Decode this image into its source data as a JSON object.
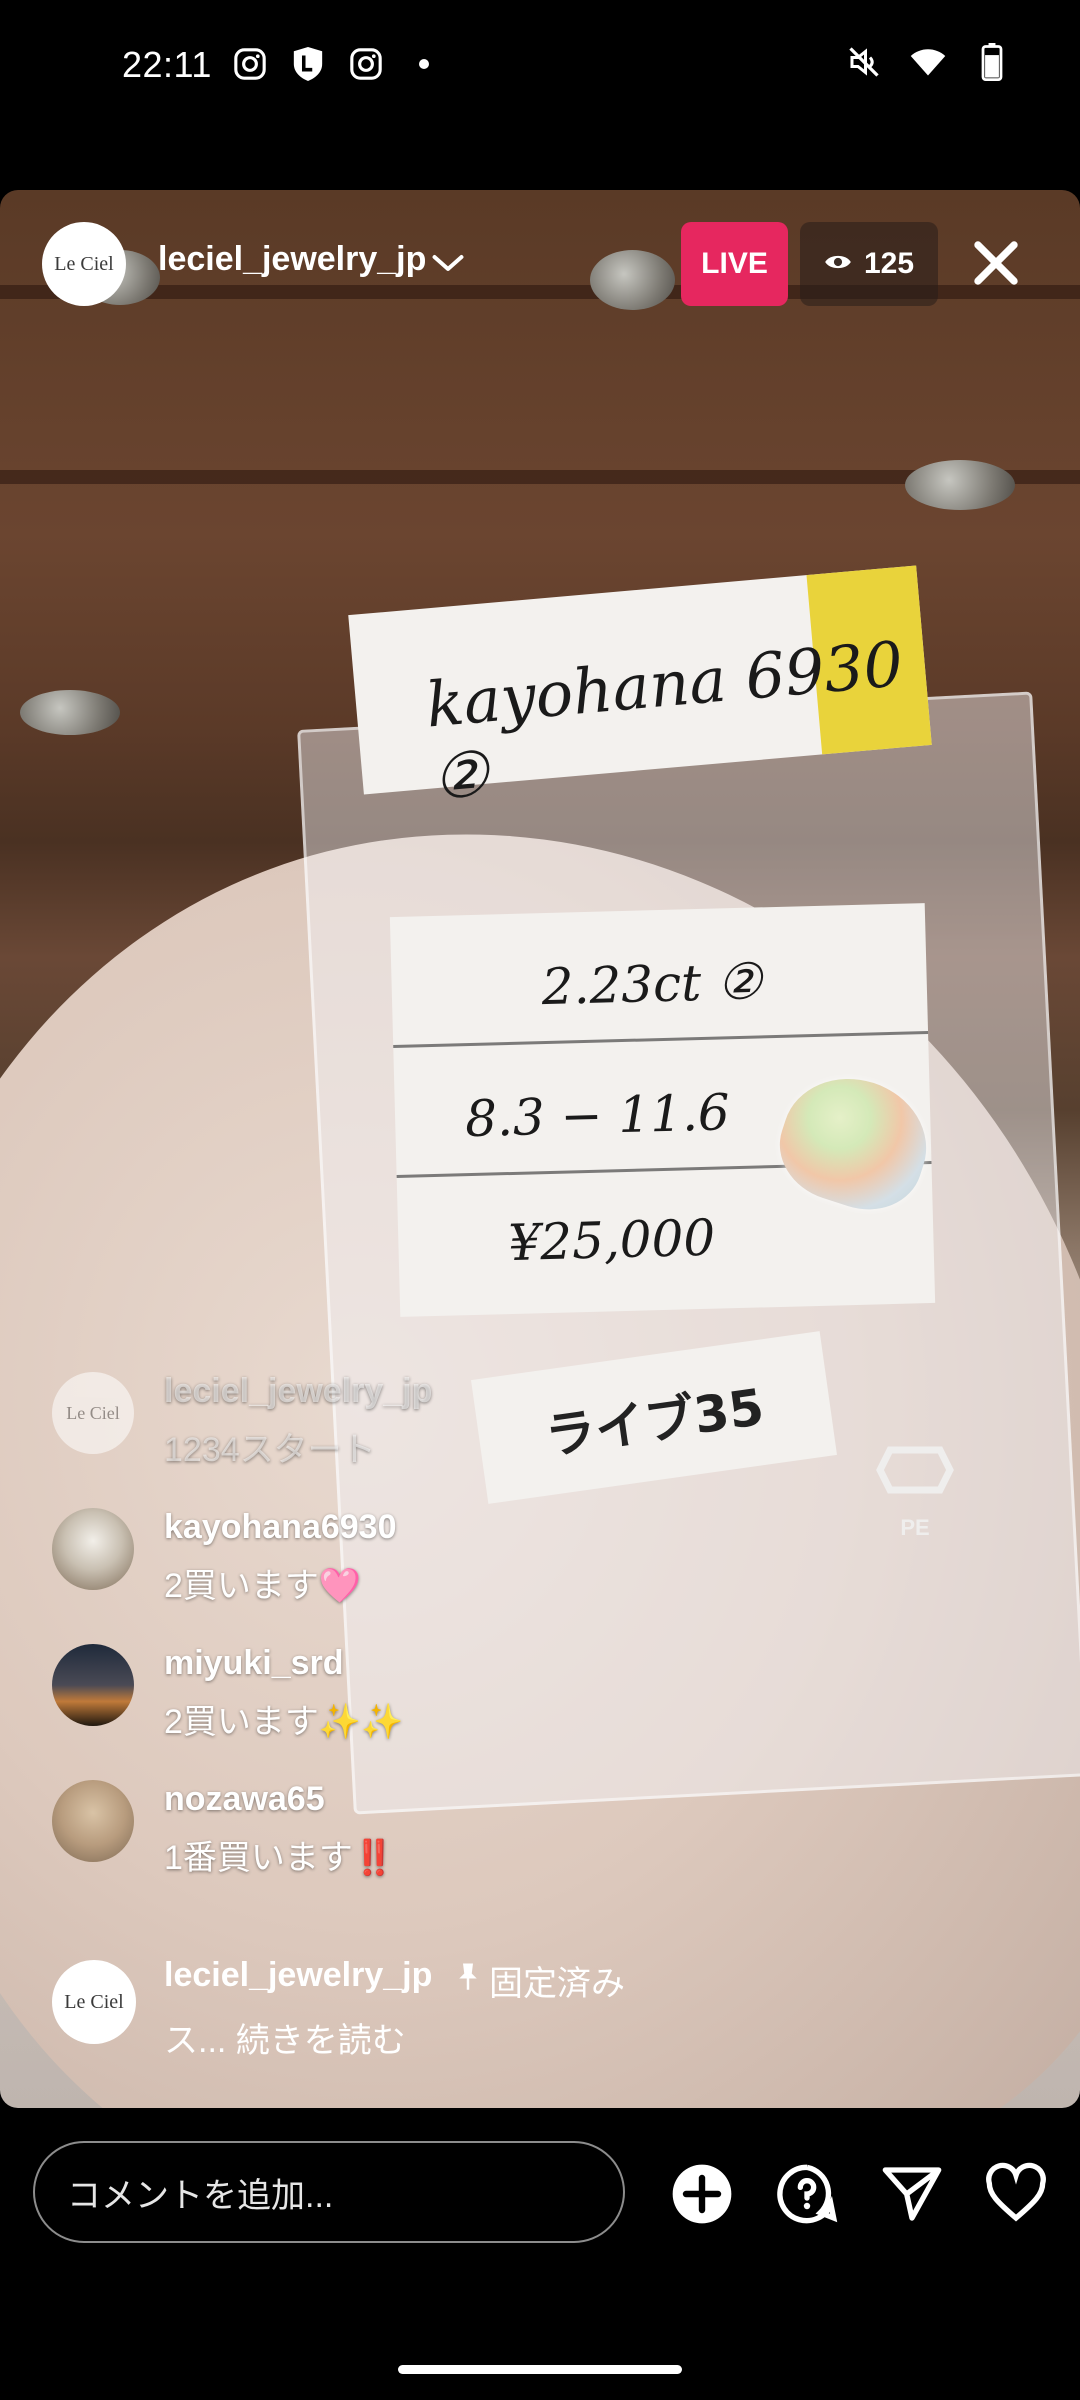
{
  "status_bar": {
    "time": "22:11"
  },
  "live": {
    "host_username": "leciel_jewelry_jp",
    "host_avatar_text": "Le Ciel",
    "live_label": "LIVE",
    "viewer_count": "125"
  },
  "video_scene": {
    "label_top": "kayohana 6930 ②",
    "price_rows": [
      "2.23ct ②",
      "8.3 − 11.6",
      "¥25,000"
    ],
    "live_tag": "ライブ35",
    "bag_mark": "PE"
  },
  "comments": [
    {
      "username": "leciel_jewelry_jp",
      "text": "1234スタート",
      "faded": true
    },
    {
      "username": "kayohana6930",
      "text": "2買います🩷"
    },
    {
      "username": "miyuki_srd",
      "text": "2買います✨✨"
    },
    {
      "username": "nozawa65",
      "text": "1番買います‼️"
    }
  ],
  "pinned": {
    "username": "leciel_jewelry_jp",
    "tag": "固定済み",
    "text": "ス... 続きを読む"
  },
  "bottom_bar": {
    "comment_placeholder": "コメントを追加..."
  },
  "colors": {
    "live_badge": "#e6275f",
    "accent_text": "#ffffff"
  },
  "icons": [
    "instagram-icon",
    "lock-icon",
    "mute-icon",
    "wifi-icon",
    "battery-icon",
    "eye-icon",
    "close-icon",
    "add-icon",
    "question-icon",
    "send-icon",
    "heart-icon",
    "pin-icon"
  ]
}
